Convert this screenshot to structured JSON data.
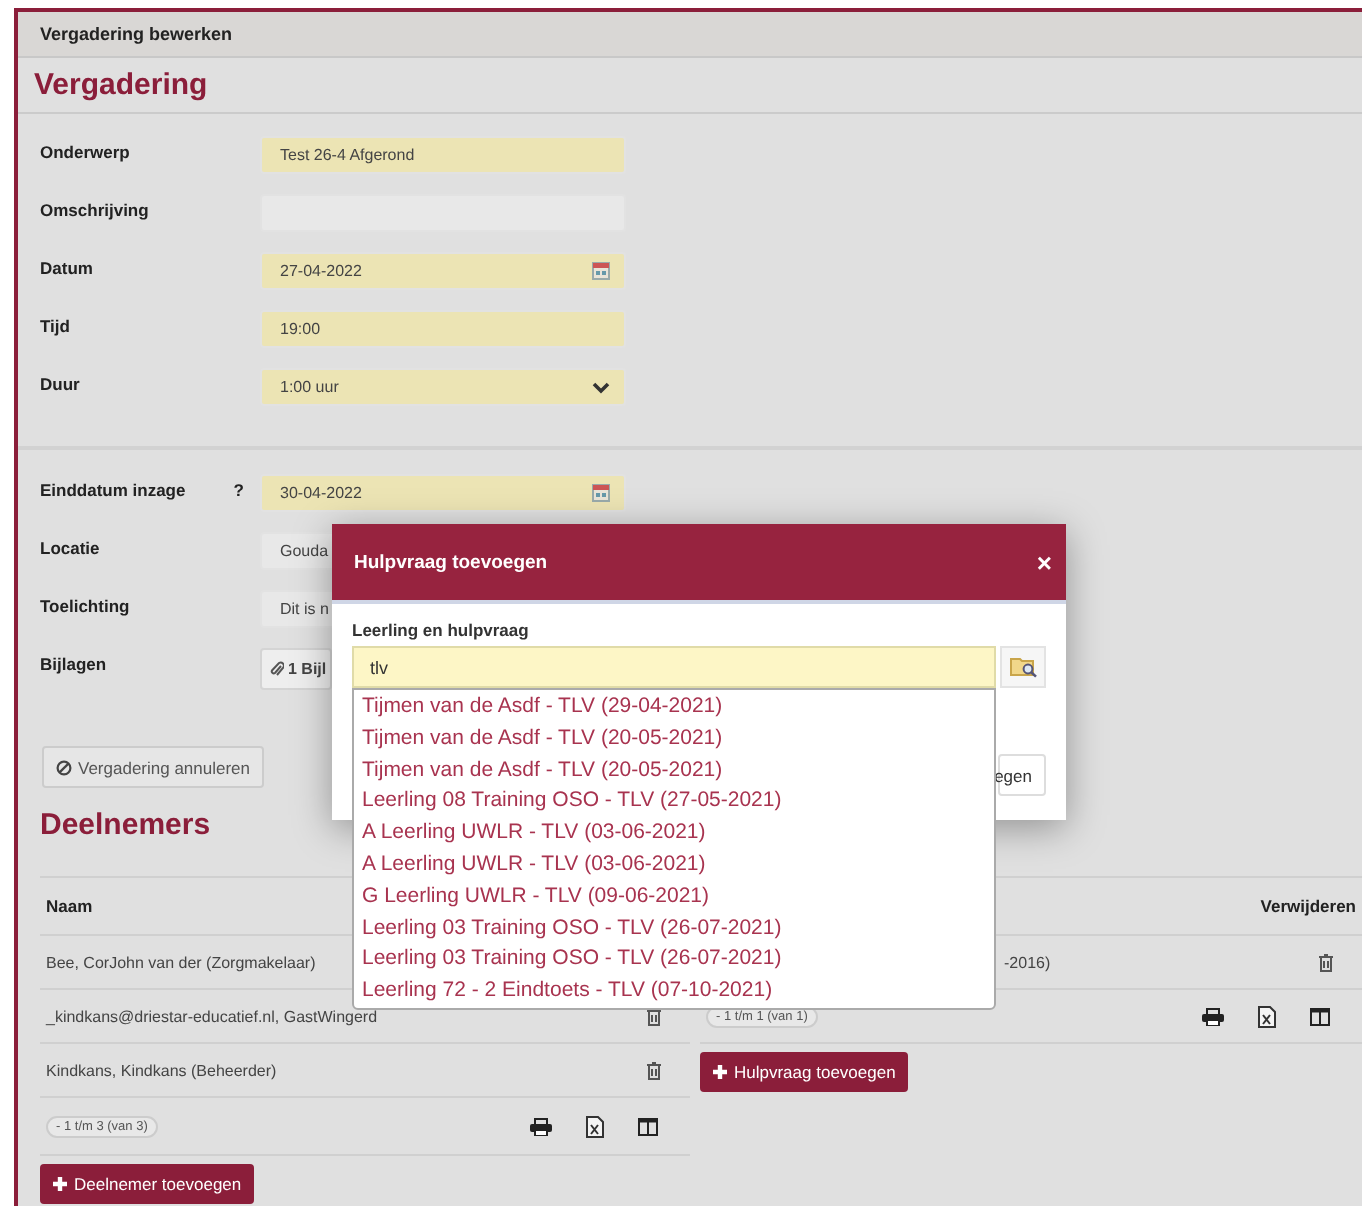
{
  "page_title": "Vergadering bewerken",
  "heading": "Vergadering",
  "fields": [
    {
      "label": "Onderwerp",
      "value": "Test 26-4 Afgerond",
      "kind": "text",
      "required": true
    },
    {
      "label": "Omschrijving",
      "kind": "text",
      "required": false
    },
    {
      "label": "Datum",
      "value": "27-04-2022",
      "kind": "date",
      "required": true
    },
    {
      "label": "Tijd",
      "value": "19:00",
      "kind": "text",
      "required": true
    },
    {
      "label": "Duur",
      "value": "1:00 uur",
      "kind": "select",
      "required": true
    }
  ],
  "fields_2": [
    {
      "label": "Einddatum inzage",
      "help": "?",
      "value": "30-04-2022",
      "kind": "date",
      "required": true
    },
    {
      "label": "Locatie",
      "value": "Gouda",
      "kind": "text",
      "required": false
    },
    {
      "label": "Toelichting",
      "value": "Dit is n",
      "kind": "text",
      "required": false
    },
    {
      "label": "Bijlagen",
      "value": "1 Bijl",
      "kind": "attachment",
      "required": false
    }
  ],
  "cancel_button": "Vergadering annuleren",
  "participants": {
    "heading": "Deelnemers",
    "columns": [
      "Naam"
    ],
    "rows": [
      {
        "name": "Bee, CorJohn van der (Zorgmakelaar)"
      },
      {
        "name": "_kindkans@driestar-educatief.nl, GastWingerd",
        "delete_icon": true
      },
      {
        "name": "Kindkans, Kindkans (Beheerder)",
        "delete_icon": true
      }
    ],
    "pager": "- 1 t/m 3 (van 3)",
    "add_button": "Deelnemer toevoegen"
  },
  "help_requests": {
    "columns": [
      "Verwijderen"
    ],
    "rows": [
      {
        "name": "-2016)"
      }
    ],
    "pager": "- 1 t/m 1 (van 1)",
    "add_button": "Hulpvraag toevoegen"
  },
  "modal": {
    "title": "Hulpvraag toevoegen",
    "close": "×",
    "field_label": "Leerling en hulpvraag",
    "value": "tlv",
    "button": "egen",
    "suggestions": [
      "Tijmen van de Asdf - TLV (29-04-2021)",
      "Tijmen van de Asdf - TLV (20-05-2021)",
      "Tijmen van de Asdf - TLV (20-05-2021)",
      "Leerling 08 Training OSO - TLV (27-05-2021)",
      "A Leerling UWLR - TLV (03-06-2021)",
      "A Leerling UWLR - TLV (03-06-2021)",
      "G Leerling UWLR - TLV (09-06-2021)",
      "Leerling 03 Training OSO - TLV (26-07-2021)",
      "Leerling 03 Training OSO - TLV (26-07-2021)",
      "Leerling 72 - 2 Eindtoets - TLV (07-10-2021)"
    ]
  }
}
